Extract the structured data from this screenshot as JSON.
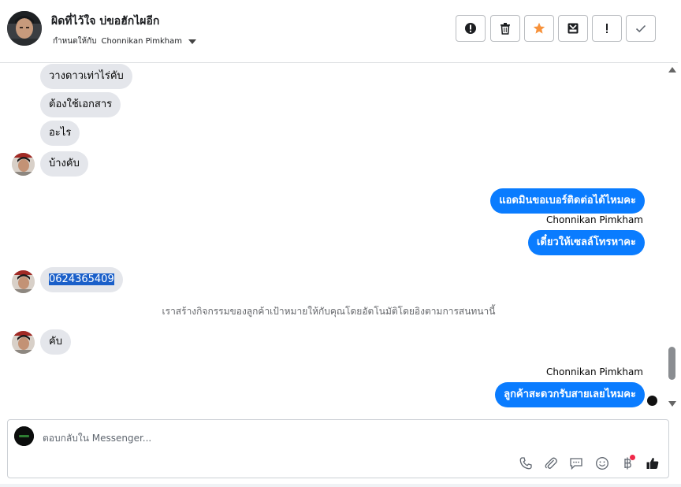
{
  "header": {
    "contact_name": "ผิดที่ไว้ใจ บ่ขอฮักไผอีก",
    "assign_prefix": "กำหนดให้กับ",
    "assignee": "Chonnikan Pimkham",
    "actions": [
      {
        "name": "mark-spam-button",
        "icon": "exclamation-circle-icon"
      },
      {
        "name": "delete-button",
        "icon": "trash-icon"
      },
      {
        "name": "star-button",
        "icon": "star-icon",
        "color": "#f7923b"
      },
      {
        "name": "archive-button",
        "icon": "archive-icon"
      },
      {
        "name": "follow-up-button",
        "icon": "exclamation-icon"
      },
      {
        "name": "mark-done-button",
        "icon": "check-icon"
      }
    ]
  },
  "thread": {
    "in_messages": [
      "วางดาวเท่าไร่คับ",
      "ต้องใช้เอกสาร",
      "อะไร",
      "บ้างคับ",
      "0624365409",
      "คับ"
    ],
    "out_messages": [
      "แอดมินขอเบอร์ติดต่อได้ไหมคะ",
      "เดี๋ยวให้เซลล์โทรหาคะ",
      "ลูกค้าสะดวกรับสายเลยไหมคะ"
    ],
    "senders": [
      "Chonnikan Pimkham",
      "Chonnikan Pimkham"
    ],
    "system_note": "เราสร้างกิจกรรมของลูกค้าเป้าหมายให้กับคุณโดยอัตโนมัติโดยอิงตามการสนทนานี้"
  },
  "composer": {
    "placeholder": "ตอบกลับใน Messenger...",
    "tools": [
      "phone-icon",
      "paperclip-icon",
      "saved-reply-icon",
      "emoji-icon",
      "baht-icon",
      "thumbs-up-icon"
    ],
    "accent": "#0a7cff"
  }
}
